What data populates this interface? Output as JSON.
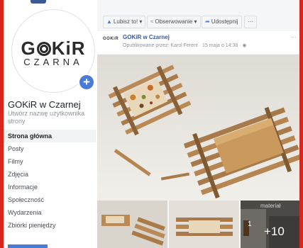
{
  "page": {
    "name": "GOKiR w Czarnej",
    "handle_hint": "Utwórz nazwę użytkownika strony"
  },
  "logo": {
    "line1_left": "G",
    "line1_right": "KiR",
    "line2": "CZARNA"
  },
  "add_button": "+",
  "nav": [
    {
      "label": "Strona główna",
      "active": true
    },
    {
      "label": "Posty"
    },
    {
      "label": "Filmy"
    },
    {
      "label": "Zdjęcia"
    },
    {
      "label": "Informacje"
    },
    {
      "label": "Społeczność"
    },
    {
      "label": "Wydarzenia"
    },
    {
      "label": "Zbiórki pieniędzy"
    }
  ],
  "actionbar": {
    "like": "Lubisz to! ▾",
    "follow": "Obserwowanie ▾",
    "share": "Udostępnij",
    "more": "···"
  },
  "post": {
    "logo_text": "GOKiR",
    "title": "GOKiR w Czarnej",
    "meta": "Opublikowane przez: Karol Ferent  ·  15 maja o 14:38 · ",
    "dots": "···"
  },
  "thumbs": {
    "more_count": "+10",
    "material_label": "materiał",
    "number": "1"
  },
  "colors": {
    "accent": "#4b7bd8",
    "link": "#385898",
    "frame": "#d9261c"
  }
}
